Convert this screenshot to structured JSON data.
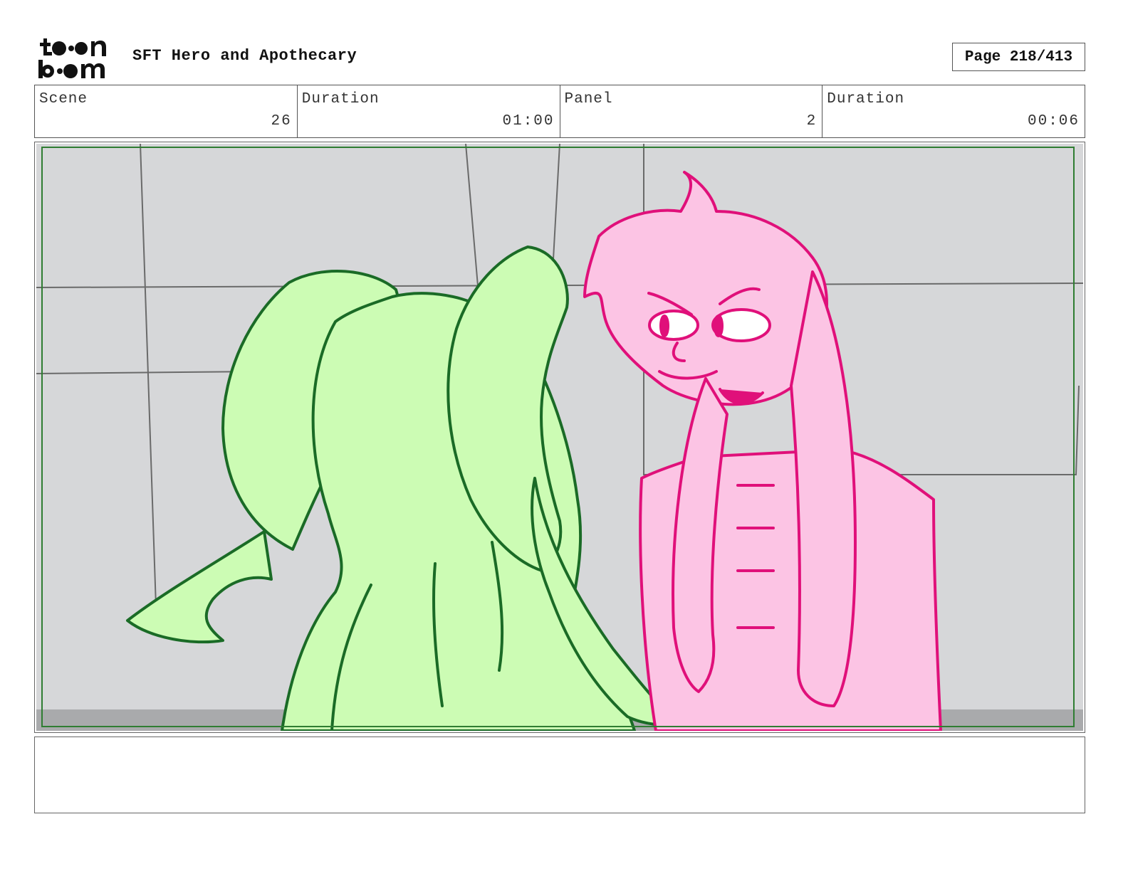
{
  "header": {
    "project_title": "SFT Hero and Apothecary",
    "page_indicator": "Page 218/413"
  },
  "info": {
    "scene_label": "Scene",
    "scene_value": "26",
    "scene_duration_label": "Duration",
    "scene_duration_value": "01:00",
    "panel_label": "Panel",
    "panel_value": "2",
    "panel_duration_label": "Duration",
    "panel_duration_value": "00:06"
  },
  "colors": {
    "green_char_fill": "#ccfcb4",
    "green_char_line": "#1a6b26",
    "pink_char_fill": "#fcc4e4",
    "pink_char_line": "#e0107a",
    "background_wall": "#d6d7d9",
    "safe_frame": "#2f7d32"
  },
  "icons": {
    "logo": "toon-boom-logo"
  },
  "notes": {
    "text": ""
  }
}
